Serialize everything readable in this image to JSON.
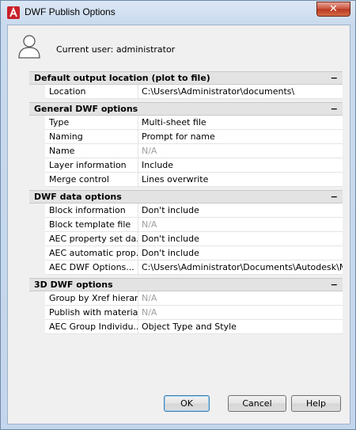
{
  "window": {
    "title": "DWF Publish Options"
  },
  "user": {
    "label": "Current user: administrator"
  },
  "sections": [
    {
      "title": "Default output location (plot to file)",
      "rows": [
        {
          "name": "Location",
          "value": "C:\\Users\\Administrator\\documents\\",
          "disabled": false
        }
      ]
    },
    {
      "title": "General DWF options",
      "rows": [
        {
          "name": "Type",
          "value": "Multi-sheet file",
          "disabled": false
        },
        {
          "name": "Naming",
          "value": "Prompt for name",
          "disabled": false
        },
        {
          "name": "Name",
          "value": "N/A",
          "disabled": true
        },
        {
          "name": "Layer information",
          "value": "Include",
          "disabled": false
        },
        {
          "name": "Merge control",
          "value": "Lines overwrite",
          "disabled": false
        }
      ]
    },
    {
      "title": "DWF data options",
      "rows": [
        {
          "name": "Block information",
          "value": "Don't include",
          "disabled": false
        },
        {
          "name": "Block template file",
          "value": "N/A",
          "disabled": true
        },
        {
          "name": "AEC property set da...",
          "value": "Don't include",
          "disabled": false
        },
        {
          "name": "AEC automatic prop...",
          "value": "Don't include",
          "disabled": false
        },
        {
          "name": "AEC DWF Options...",
          "value": "C:\\Users\\Administrator\\Documents\\Autodesk\\My P...",
          "disabled": false
        }
      ]
    },
    {
      "title": "3D DWF options",
      "rows": [
        {
          "name": "Group by Xref hierar...",
          "value": "N/A",
          "disabled": true
        },
        {
          "name": "Publish with materials",
          "value": "N/A",
          "disabled": true
        },
        {
          "name": "AEC Group Individu...",
          "value": "Object Type and Style",
          "disabled": false
        }
      ]
    }
  ],
  "collapse_symbol": "−",
  "buttons": {
    "ok": "OK",
    "cancel": "Cancel",
    "help": "Help"
  },
  "close_symbol": "✕"
}
